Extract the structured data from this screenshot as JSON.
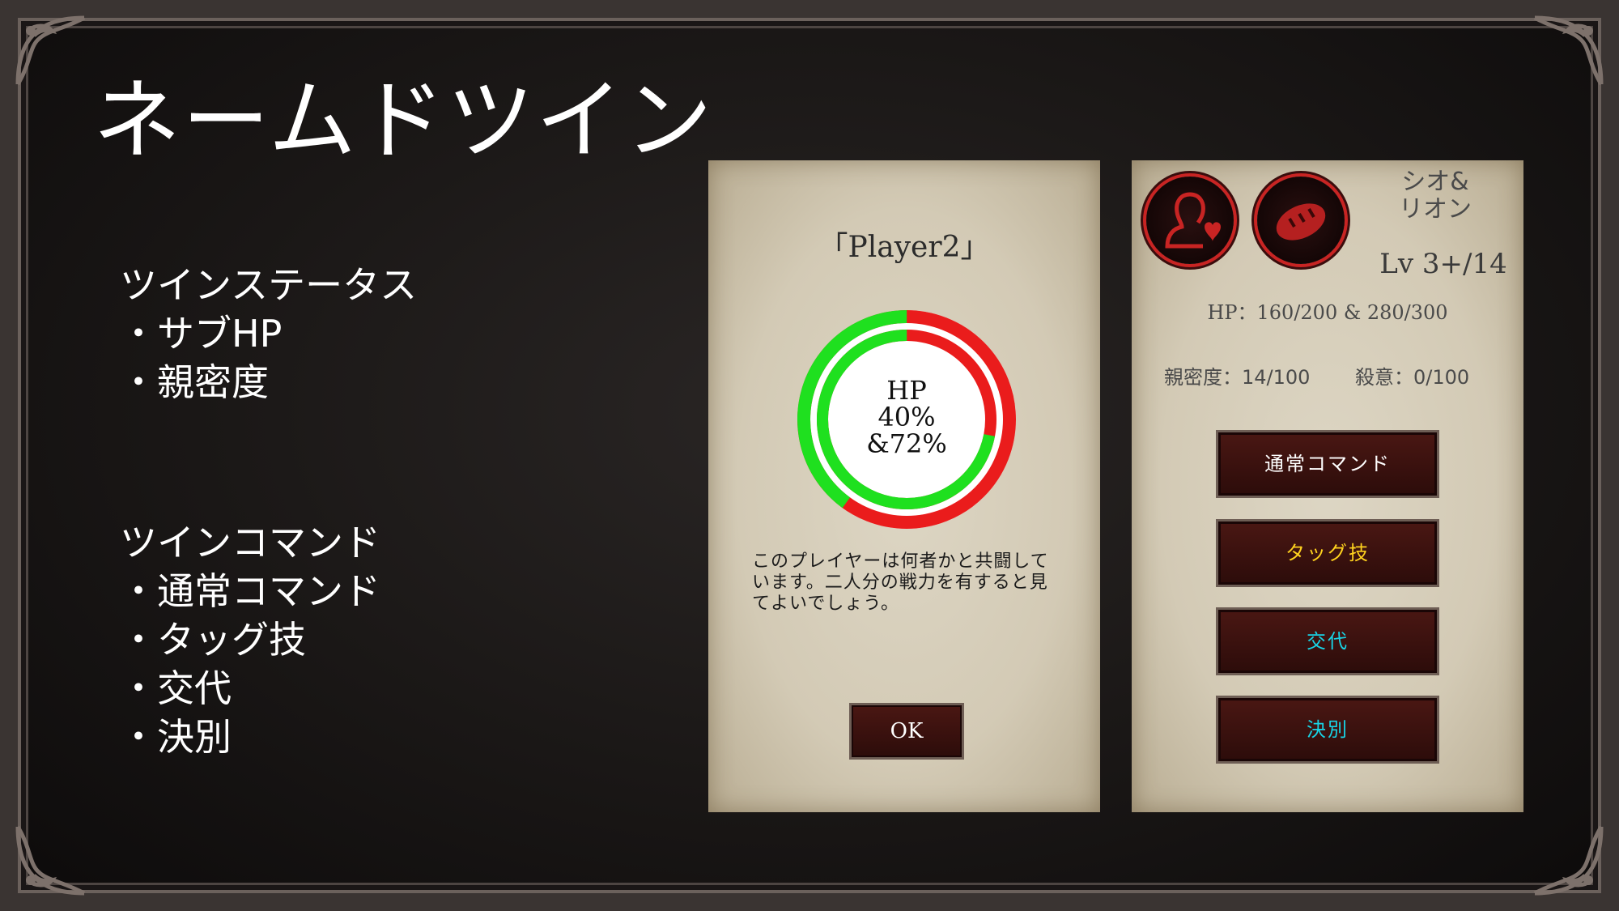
{
  "title": "ネームドツイン",
  "features": {
    "status_heading": "ツインステータス",
    "status_items": [
      "・サブHP",
      "・親密度"
    ],
    "command_heading": "ツインコマンド",
    "command_items": [
      "・通常コマンド",
      "・タッグ技",
      "・交代",
      "・決別"
    ]
  },
  "player_panel": {
    "name": "「Player2」",
    "hp_label": "HP",
    "hp_primary": "40%",
    "hp_secondary": "&72%",
    "hp_primary_fraction": 0.4,
    "hp_secondary_fraction": 0.72,
    "description": "このプレイヤーは何者かと共闘しています。二人分の戦力を有すると見てよいでしょう。",
    "ok_label": "OK"
  },
  "twin_panel": {
    "icons": [
      "twin-bond-icon",
      "bread-icon"
    ],
    "pair_name_line1": "シオ&",
    "pair_name_line2": "リオン",
    "level": "Lv 3+/14",
    "hp": "HP：160/200 & 280/300",
    "intimacy": "親密度：14/100",
    "hostility": "殺意：0/100",
    "commands": [
      {
        "label": "通常コマンド",
        "color": "#ffffff"
      },
      {
        "label": "タッグ技",
        "color": "#ffd21e"
      },
      {
        "label": "交代",
        "color": "#18d4e6"
      },
      {
        "label": "決別",
        "color": "#18d4e6"
      }
    ]
  },
  "colors": {
    "hp_full": "#1fe01f",
    "hp_lost": "#ea1c1c",
    "button_bg": "#3a100d",
    "panel_bg": "#d6cdb8"
  }
}
